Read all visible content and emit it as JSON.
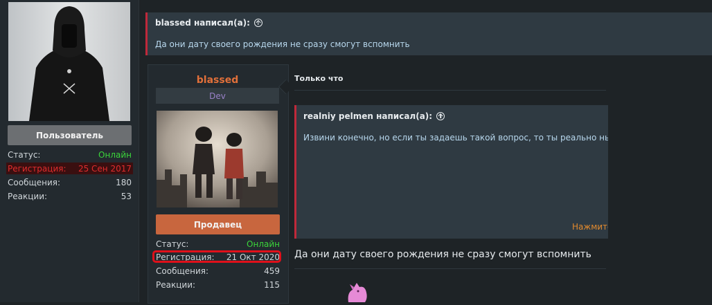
{
  "left_card": {
    "role": "Пользователь",
    "stats": [
      {
        "label": "Статус:",
        "value": "Онлайн"
      },
      {
        "label": "Регистрация:",
        "value": "25 Сен 2017"
      },
      {
        "label": "Сообщения:",
        "value": "180"
      },
      {
        "label": "Реакции:",
        "value": "53"
      }
    ]
  },
  "top_quote": {
    "author": "blassed написал(а):",
    "text": "Да они дату своего рождения не сразу смогут вспомнить"
  },
  "post_user": {
    "name": "blassed",
    "title": "Dev",
    "role": "Продавец",
    "stats": [
      {
        "label": "Статус:",
        "value": "Онлайн"
      },
      {
        "label": "Регистрация:",
        "value": "21 Окт 2020"
      },
      {
        "label": "Сообщения:",
        "value": "459"
      },
      {
        "label": "Реакции:",
        "value": "115"
      }
    ]
  },
  "post": {
    "time": "Только что",
    "quote_author": "realniy pelmen написал(а):",
    "quote_text": "Извини конечно, но если ты задаешь такой вопрос, то ты реально ньюка",
    "quote_expand": "Нажмите",
    "text": "Да они дату своего рождения не сразу смогут вспомнить"
  },
  "colors": {
    "accent_red": "#c0293a",
    "online_green": "#3bd63b",
    "username_orange": "#e2703a",
    "seller_button": "#c8663e",
    "highlight": "#e0101a"
  }
}
